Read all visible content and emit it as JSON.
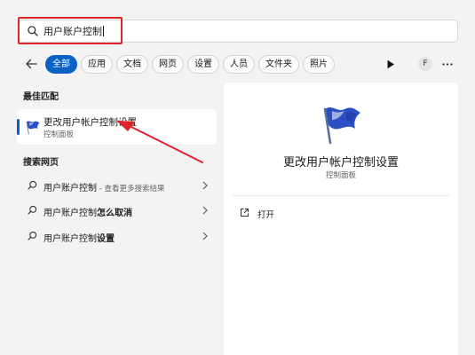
{
  "search": {
    "query": "用户账户控制"
  },
  "filters": [
    {
      "label": "全部",
      "active": true
    },
    {
      "label": "应用"
    },
    {
      "label": "文档"
    },
    {
      "label": "网页"
    },
    {
      "label": "设置"
    },
    {
      "label": "人员"
    },
    {
      "label": "文件夹"
    },
    {
      "label": "照片"
    }
  ],
  "toolbar": {
    "avatar_initial": "F"
  },
  "best_match": {
    "section_label": "最佳匹配",
    "title": "更改用户帐户控制设置",
    "subtitle": "控制面板"
  },
  "web_search": {
    "section_label": "搜索网页",
    "items": [
      {
        "prefix": "用户账户控制",
        "bold": "",
        "sub": " - 查看更多搜索结果"
      },
      {
        "prefix": "用户账户控制",
        "bold": "怎么取消",
        "sub": ""
      },
      {
        "prefix": "用户账户控制",
        "bold": "设置",
        "sub": ""
      }
    ]
  },
  "detail": {
    "title": "更改用户帐户控制设置",
    "subtitle": "控制面板",
    "open_label": "打开"
  },
  "colors": {
    "accent": "#0b62c4",
    "annotation_red": "#e0242b",
    "flag_blue": "#2d4fc4"
  }
}
